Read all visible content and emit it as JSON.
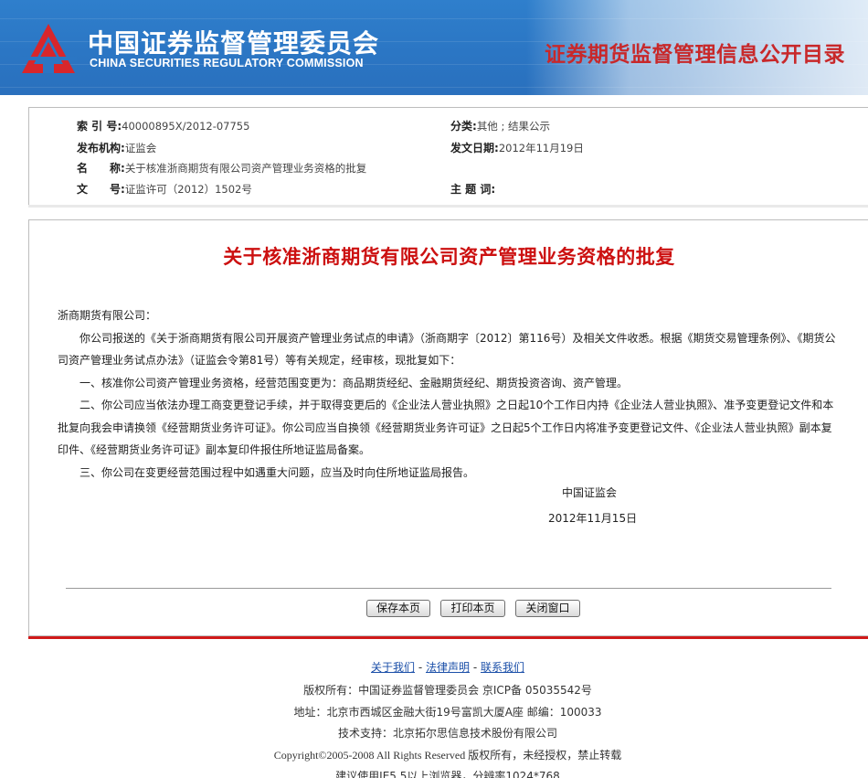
{
  "header": {
    "cn_title": "中国证券监督管理委员会",
    "en_title": "CHINA SECURITIES REGULATORY COMMISSION",
    "right_title": "证券期货监督管理信息公开目录",
    "accent_color": "#c8282a",
    "bg_color": "#2b76c4"
  },
  "meta": {
    "index_label": "索 引 号:",
    "index_value": "40000895X/2012-07755",
    "category_label": "分类:",
    "category_value": "其他 ; 结果公示",
    "issuer_label": "发布机构:",
    "issuer_value": "证监会",
    "date_label": "发文日期:",
    "date_value": "2012年11月19日",
    "name_label": "名　　称:",
    "name_value": "关于核准浙商期货有限公司资产管理业务资格的批复",
    "docno_label": "文　　号:",
    "docno_value": "证监许可（2012）1502号",
    "keyword_label": "主 题 词:",
    "keyword_value": ""
  },
  "document": {
    "title": "关于核准浙商期货有限公司资产管理业务资格的批复",
    "addressee": "浙商期货有限公司：",
    "para1": "你公司报送的《关于浙商期货有限公司开展资产管理业务试点的申请》（浙商期字〔2012〕第116号）及相关文件收悉。根据《期货交易管理条例》、《期货公司资产管理业务试点办法》（证监会令第81号）等有关规定，经审核，现批复如下：",
    "para2": "一、核准你公司资产管理业务资格，经营范围变更为：商品期货经纪、金融期货经纪、期货投资咨询、资产管理。",
    "para3": "二、你公司应当依法办理工商变更登记手续，并于取得变更后的《企业法人营业执照》之日起10个工作日内持《企业法人营业执照》、准予变更登记文件和本批复向我会申请换领《经营期货业务许可证》。你公司应当自换领《经营期货业务许可证》之日起5个工作日内将准予变更登记文件、《企业法人营业执照》副本复印件、《经营期货业务许可证》副本复印件报住所地证监局备案。",
    "para4": "三、你公司在变更经营范围过程中如遇重大问题，应当及时向住所地证监局报告。",
    "signer": "中国证监会",
    "sign_date": "2012年11月15日",
    "title_color": "#cc1010"
  },
  "buttons": {
    "save": "保存本页",
    "print": "打印本页",
    "close": "关闭窗口"
  },
  "footer": {
    "about": "关于我们",
    "legal": "法律声明",
    "contact": "联系我们",
    "sep": " - ",
    "copyright_owner": "版权所有：中国证券监督管理委员会  京ICP备  05035542号",
    "address": "地址：北京市西城区金融大街19号富凯大厦A座  邮编：100033",
    "tech": "技术支持：北京拓尔思信息技术股份有限公司",
    "copyright": "Copyright©2005-2008 All Rights Reserved 版权所有，未经授权，禁止转载",
    "browser": "建议使用IE5.5以上浏览器，分辨率1024*768"
  }
}
